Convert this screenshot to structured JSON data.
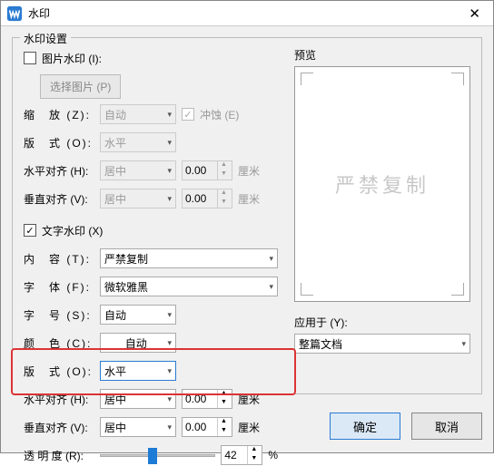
{
  "window": {
    "title": "水印"
  },
  "fieldset_title": "水印设置",
  "image_wm": {
    "checkbox_label": "图片水印 (I):",
    "checked": false,
    "choose_btn": "选择图片 (P)",
    "zoom_label": "缩　放 (Z):",
    "zoom_value": "自动",
    "washout_label": "冲蚀 (E)",
    "layout_label": "版　式 (O):",
    "layout_value": "水平",
    "halign_label": "水平对齐 (H):",
    "halign_value": "居中",
    "halign_num": "0.00",
    "valign_label": "垂直对齐 (V):",
    "valign_value": "居中",
    "valign_num": "0.00",
    "unit": "厘米"
  },
  "text_wm": {
    "checkbox_label": "文字水印 (X)",
    "checked": true,
    "content_label": "内　容 (T):",
    "content_value": "严禁复制",
    "font_label": "字　体 (F):",
    "font_value": "微软雅黑",
    "size_label": "字　号 (S):",
    "size_value": "自动",
    "color_label": "颜　色 (C):",
    "color_value": "自动",
    "layout_label": "版　式 (O):",
    "layout_value": "水平",
    "halign_label": "水平对齐 (H):",
    "halign_value": "居中",
    "halign_num": "0.00",
    "valign_label": "垂直对齐 (V):",
    "valign_value": "居中",
    "valign_num": "0.00",
    "unit": "厘米",
    "opacity_label": "透 明 度 (R):",
    "opacity_value": "42",
    "opacity_unit": "%"
  },
  "preview": {
    "label": "预览",
    "text": "严禁复制"
  },
  "apply": {
    "label": "应用于 (Y):",
    "value": "整篇文档"
  },
  "buttons": {
    "ok": "确定",
    "cancel": "取消"
  }
}
